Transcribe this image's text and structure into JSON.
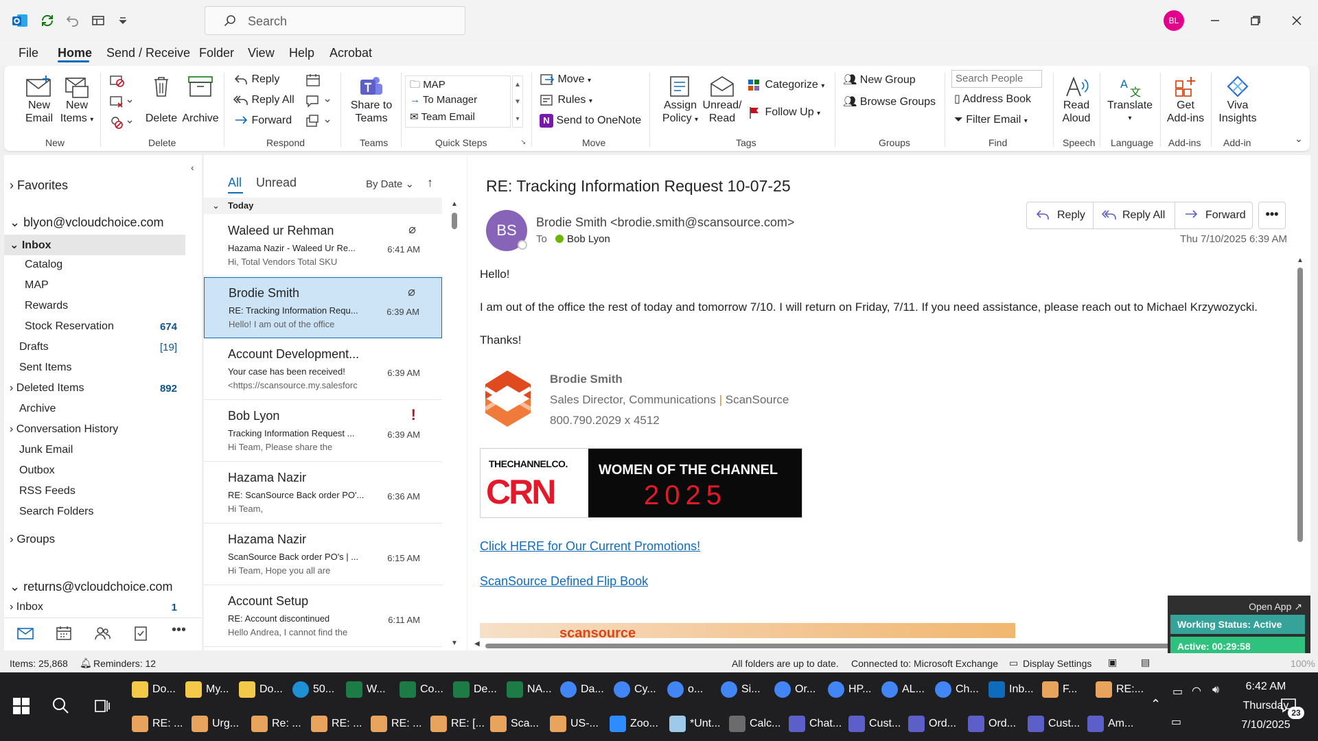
{
  "titlebar": {
    "search_placeholder": "Search",
    "avatar_initials": "BL"
  },
  "menu": {
    "tabs": [
      "File",
      "Home",
      "Send / Receive",
      "Folder",
      "View",
      "Help",
      "Acrobat"
    ],
    "active": "Home"
  },
  "ribbon": {
    "new_email": [
      "New",
      "Email"
    ],
    "new_items": [
      "New",
      "Items"
    ],
    "delete": "Delete",
    "archive": "Archive",
    "reply": "Reply",
    "reply_all": "Reply All",
    "forward": "Forward",
    "share_to_teams": [
      "Share to",
      "Teams"
    ],
    "quick_steps": [
      "MAP",
      "To Manager",
      "Team Email"
    ],
    "move": "Move",
    "rules": "Rules",
    "send_to_onenote": "Send to OneNote",
    "assign_policy": [
      "Assign",
      "Policy"
    ],
    "unread_read": [
      "Unread/",
      "Read"
    ],
    "categorize": "Categorize",
    "follow_up": "Follow Up",
    "new_group": "New Group",
    "browse_groups": "Browse Groups",
    "search_people_placeholder": "Search People",
    "address_book": "Address Book",
    "filter_email": "Filter Email",
    "read_aloud": [
      "Read",
      "Aloud"
    ],
    "translate": "Translate",
    "get_addins": [
      "Get",
      "Add-ins"
    ],
    "viva_insights": [
      "Viva",
      "Insights"
    ],
    "groups": [
      "New",
      "Delete",
      "Respond",
      "Teams",
      "Quick Steps",
      "Move",
      "Tags",
      "Groups",
      "Find",
      "Speech",
      "Language",
      "Add-ins",
      "Add-in"
    ]
  },
  "folders": {
    "favorites": "Favorites",
    "account1": "blyon@vcloudchoice.com",
    "items": [
      {
        "label": "Inbox",
        "count": ""
      },
      {
        "label": "Catalog",
        "count": ""
      },
      {
        "label": "MAP",
        "count": ""
      },
      {
        "label": "Rewards",
        "count": ""
      },
      {
        "label": "Stock Reservation",
        "count": "674"
      },
      {
        "label": "Drafts",
        "count": "[19]"
      },
      {
        "label": "Sent Items",
        "count": ""
      },
      {
        "label": "Deleted Items",
        "count": "892"
      },
      {
        "label": "Archive",
        "count": ""
      },
      {
        "label": "Conversation History",
        "count": ""
      },
      {
        "label": "Junk Email",
        "count": ""
      },
      {
        "label": "Outbox",
        "count": ""
      },
      {
        "label": "RSS Feeds",
        "count": ""
      },
      {
        "label": "Search Folders",
        "count": ""
      }
    ],
    "groups": "Groups",
    "account2": "returns@vcloudchoice.com",
    "inbox2": {
      "label": "Inbox",
      "count": "1"
    }
  },
  "list": {
    "tab_all": "All",
    "tab_unread": "Unread",
    "sort": "By Date",
    "group_today": "Today",
    "messages": [
      {
        "sender": "Waleed ur Rehman",
        "subject": "Hazama Nazir - Waleed Ur Re...",
        "preview": "Hi,  Total Vendors  Total SKU",
        "time": "6:41 AM"
      },
      {
        "sender": "Brodie Smith",
        "subject": "RE: Tracking Information Requ...",
        "preview": "Hello!   I am out of the office",
        "time": "6:39 AM"
      },
      {
        "sender": "Account Development...",
        "subject": "Your case has been received!",
        "preview": "<https://scansource.my.salesforc",
        "time": "6:39 AM"
      },
      {
        "sender": "Bob Lyon",
        "subject": "Tracking Information Request  ...",
        "preview": "Hi Team,    Please share the",
        "time": "6:39 AM"
      },
      {
        "sender": "Hazama Nazir",
        "subject": "RE: ScanSource Back order PO'...",
        "preview": "Hi Team,",
        "time": "6:36 AM"
      },
      {
        "sender": "Hazama Nazir",
        "subject": "ScanSource Back order PO's | ...",
        "preview": "Hi Team,  Hope you all are",
        "time": "6:15 AM"
      },
      {
        "sender": "Account Setup",
        "subject": "RE: Account discontinued",
        "preview": "Hello Andrea,  I cannot find the",
        "time": "6:11 AM"
      }
    ]
  },
  "email": {
    "subject": "RE: Tracking Information Request  10-07-25",
    "sender_initials": "BS",
    "from": "Brodie Smith <brodie.smith@scansource.com>",
    "to_label": "To",
    "to": "Bob Lyon",
    "date": "Thu 7/10/2025 6:39 AM",
    "reply": "Reply",
    "reply_all": "Reply All",
    "forward": "Forward",
    "greeting": "Hello!",
    "body": "I am out of the office the rest of today and tomorrow 7/10.  I will return on Friday, 7/11. If you need assistance,  please reach out to Michael Krzywozycki.",
    "thanks": "Thanks!",
    "sig_name": "Brodie Smith",
    "sig_title": "Sales Director, Communications",
    "sig_sep": "|",
    "sig_company": "ScanSource",
    "sig_phone": "800.790.2029 x 4512",
    "banner_brand_top": "THECHANNELCO.",
    "banner_brand": "CRN",
    "banner_title": "WOMEN OF THE CHANNEL",
    "banner_year": "2025",
    "link1": "Click HERE for Our Current Promotions!",
    "link2": "ScanSource Defined Flip Book",
    "bottom_brand": "scansource"
  },
  "overlay": {
    "open_app": "Open App ↗",
    "working_status": "Working Status: Active",
    "active_timer": "Active: 00:29:58"
  },
  "status": {
    "items": "Items: 25,868",
    "reminders": "Reminders: 12",
    "sync": "All folders are up to date.",
    "connection": "Connected to: Microsoft Exchange",
    "display": "Display Settings",
    "zoom": "100%"
  },
  "taskbar": {
    "row1": [
      {
        "label": "Do...",
        "icon": "folder",
        "color": "#f3c94a"
      },
      {
        "label": "My...",
        "icon": "folder",
        "color": "#f3c94a"
      },
      {
        "label": "Do...",
        "icon": "folder",
        "color": "#f3c94a"
      },
      {
        "label": "50...",
        "icon": "edge",
        "color": "#1e90d6"
      },
      {
        "label": "W...",
        "icon": "excel",
        "color": "#1d7c45"
      },
      {
        "label": "Co...",
        "icon": "excel",
        "color": "#1d7c45"
      },
      {
        "label": "De...",
        "icon": "excel",
        "color": "#1d7c45"
      },
      {
        "label": "NA...",
        "icon": "excel",
        "color": "#1d7c45"
      },
      {
        "label": "Da...",
        "icon": "chrome",
        "color": "#4285f4"
      },
      {
        "label": "Cy...",
        "icon": "chrome",
        "color": "#4285f4"
      },
      {
        "label": "o...",
        "icon": "chrome",
        "color": "#4285f4"
      },
      {
        "label": "Si...",
        "icon": "chrome",
        "color": "#4285f4"
      },
      {
        "label": "Or...",
        "icon": "chrome",
        "color": "#4285f4"
      },
      {
        "label": "HP...",
        "icon": "chrome",
        "color": "#4285f4"
      },
      {
        "label": "AL...",
        "icon": "chrome",
        "color": "#4285f4"
      },
      {
        "label": "Ch...",
        "icon": "chrome",
        "color": "#4285f4"
      },
      {
        "label": "Inb...",
        "icon": "outlook",
        "color": "#0f6cbd"
      },
      {
        "label": "F...",
        "icon": "mail",
        "color": "#e8a45c"
      },
      {
        "label": "RE:...",
        "icon": "mail",
        "color": "#e8a45c"
      }
    ],
    "row2": [
      {
        "label": "RE: ...",
        "icon": "mail",
        "color": "#e8a45c"
      },
      {
        "label": "Urg...",
        "icon": "mail",
        "color": "#e8a45c"
      },
      {
        "label": "Re: ...",
        "icon": "mail",
        "color": "#e8a45c"
      },
      {
        "label": "RE: ...",
        "icon": "mail",
        "color": "#e8a45c"
      },
      {
        "label": "RE: ...",
        "icon": "mail",
        "color": "#e8a45c"
      },
      {
        "label": "RE: [...",
        "icon": "mail",
        "color": "#e8a45c"
      },
      {
        "label": "Sca...",
        "icon": "mail",
        "color": "#e8a45c"
      },
      {
        "label": "US-...",
        "icon": "mail",
        "color": "#e8a45c"
      },
      {
        "label": "Zoo...",
        "icon": "zoom",
        "color": "#2d8cff"
      },
      {
        "label": "*Unt...",
        "icon": "notepad",
        "color": "#9fc9e8"
      },
      {
        "label": "Calc...",
        "icon": "calc",
        "color": "#6b6b6b"
      },
      {
        "label": "Chat...",
        "icon": "teams",
        "color": "#5b5fc7"
      },
      {
        "label": "Cust...",
        "icon": "teams",
        "color": "#5b5fc7"
      },
      {
        "label": "Ord...",
        "icon": "teams",
        "color": "#5b5fc7"
      },
      {
        "label": "Ord...",
        "icon": "teams",
        "color": "#5b5fc7"
      },
      {
        "label": "Cust...",
        "icon": "teams",
        "color": "#5b5fc7"
      },
      {
        "label": "Am...",
        "icon": "teams",
        "color": "#5b5fc7"
      }
    ],
    "time": "6:42 AM",
    "day": "Thursday",
    "date": "7/10/2025",
    "notification_count": "23"
  }
}
